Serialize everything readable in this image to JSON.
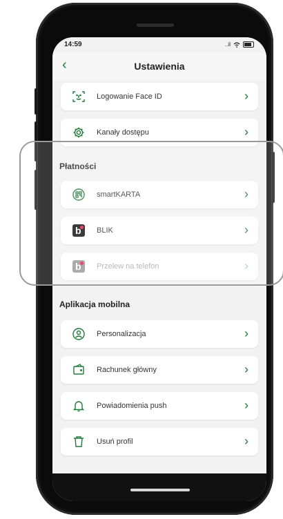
{
  "status": {
    "time": "14:59",
    "signal": "..il"
  },
  "header": {
    "title": "Ustawienia",
    "back": "‹"
  },
  "top_items": [
    {
      "label": "Logowanie Face ID",
      "icon": "face-id-icon"
    },
    {
      "label": "Kanały dostępu",
      "icon": "gear-icon"
    }
  ],
  "payments": {
    "title": "Płatności",
    "items": [
      {
        "label": "smartKARTA",
        "icon": "qr-card-icon"
      },
      {
        "label": "BLIK",
        "icon": "blik-logo-icon"
      },
      {
        "label": "Przelew na telefon",
        "icon": "blik-logo-icon",
        "disabled": true
      }
    ]
  },
  "mobile_app": {
    "title": "Aplikacja mobilna",
    "items": [
      {
        "label": "Personalizacja",
        "icon": "user-circle-icon"
      },
      {
        "label": "Rachunek główny",
        "icon": "wallet-icon"
      },
      {
        "label": "Powiadomienia push",
        "icon": "bell-icon"
      },
      {
        "label": "Usuń profil",
        "icon": "trash-icon"
      }
    ]
  },
  "colors": {
    "accent": "#1f7a3a",
    "blik_dot": "#e6224e"
  }
}
